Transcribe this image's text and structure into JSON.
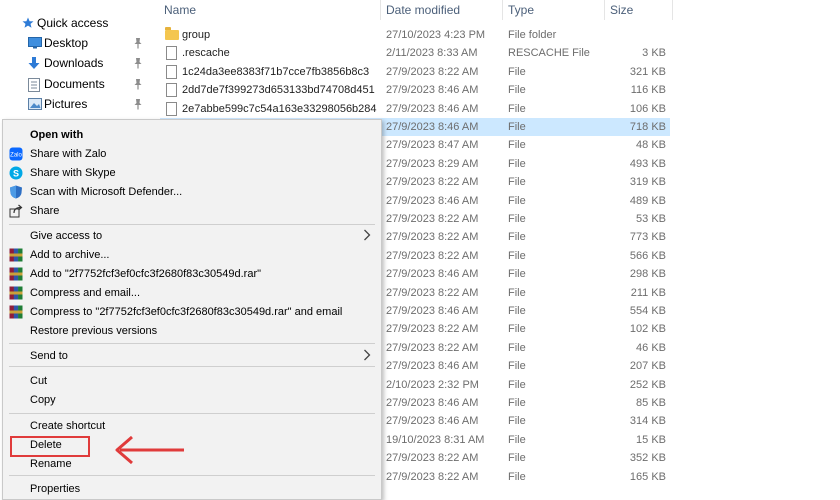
{
  "nav": {
    "items": [
      {
        "label": "Quick access",
        "icon": "star-icon",
        "pinned": false
      },
      {
        "label": "Desktop",
        "icon": "desktop-icon",
        "pinned": true
      },
      {
        "label": "Downloads",
        "icon": "download-icon",
        "pinned": true
      },
      {
        "label": "Documents",
        "icon": "document-icon",
        "pinned": true
      },
      {
        "label": "Pictures",
        "icon": "pictures-icon",
        "pinned": true
      }
    ]
  },
  "file_list": {
    "headers": [
      "Name",
      "Date modified",
      "Type",
      "Size"
    ],
    "rows": [
      {
        "name": "group",
        "date": "27/10/2023 4:23 PM",
        "type": "File folder",
        "size": "",
        "kind": "folder"
      },
      {
        "name": ".rescache",
        "date": "2/11/2023 8:33 AM",
        "type": "RESCACHE File",
        "size": "3 KB",
        "kind": "file"
      },
      {
        "name": "1c24da3ee8383f71b7cce7fb3856b8c3",
        "date": "27/9/2023 8:22 AM",
        "type": "File",
        "size": "321 KB",
        "kind": "file"
      },
      {
        "name": "2dd7de7f399273d653133bd74708d451",
        "date": "27/9/2023 8:46 AM",
        "type": "File",
        "size": "116 KB",
        "kind": "file"
      },
      {
        "name": "2e7abbe599c7c54a163e33298056b284",
        "date": "27/9/2023 8:46 AM",
        "type": "File",
        "size": "106 KB",
        "kind": "file"
      },
      {
        "name": "",
        "date": "27/9/2023 8:46 AM",
        "type": "File",
        "size": "718 KB",
        "kind": "file",
        "selected": true
      },
      {
        "name": "",
        "date": "27/9/2023 8:47 AM",
        "type": "File",
        "size": "48 KB",
        "kind": "file"
      },
      {
        "name": "",
        "date": "27/9/2023 8:29 AM",
        "type": "File",
        "size": "493 KB",
        "kind": "file"
      },
      {
        "name": "",
        "date": "27/9/2023 8:22 AM",
        "type": "File",
        "size": "319 KB",
        "kind": "file"
      },
      {
        "name": "",
        "date": "27/9/2023 8:46 AM",
        "type": "File",
        "size": "489 KB",
        "kind": "file"
      },
      {
        "name": "",
        "date": "27/9/2023 8:22 AM",
        "type": "File",
        "size": "53 KB",
        "kind": "file"
      },
      {
        "name": "",
        "date": "27/9/2023 8:22 AM",
        "type": "File",
        "size": "773 KB",
        "kind": "file"
      },
      {
        "name": "",
        "date": "27/9/2023 8:22 AM",
        "type": "File",
        "size": "566 KB",
        "kind": "file"
      },
      {
        "name": "",
        "date": "27/9/2023 8:46 AM",
        "type": "File",
        "size": "298 KB",
        "kind": "file"
      },
      {
        "name": "",
        "date": "27/9/2023 8:22 AM",
        "type": "File",
        "size": "211 KB",
        "kind": "file"
      },
      {
        "name": "",
        "date": "27/9/2023 8:46 AM",
        "type": "File",
        "size": "554 KB",
        "kind": "file"
      },
      {
        "name": "",
        "date": "27/9/2023 8:22 AM",
        "type": "File",
        "size": "102 KB",
        "kind": "file"
      },
      {
        "name": "",
        "date": "27/9/2023 8:22 AM",
        "type": "File",
        "size": "46 KB",
        "kind": "file"
      },
      {
        "name": "",
        "date": "27/9/2023 8:46 AM",
        "type": "File",
        "size": "207 KB",
        "kind": "file"
      },
      {
        "name": "",
        "date": "2/10/2023 2:32 PM",
        "type": "File",
        "size": "252 KB",
        "kind": "file"
      },
      {
        "name": "",
        "date": "27/9/2023 8:46 AM",
        "type": "File",
        "size": "85 KB",
        "kind": "file"
      },
      {
        "name": "",
        "date": "27/9/2023 8:46 AM",
        "type": "File",
        "size": "314 KB",
        "kind": "file"
      },
      {
        "name": "",
        "date": "19/10/2023 8:31 AM",
        "type": "File",
        "size": "15 KB",
        "kind": "file"
      },
      {
        "name": "",
        "date": "27/9/2023 8:22 AM",
        "type": "File",
        "size": "352 KB",
        "kind": "file"
      },
      {
        "name": "",
        "date": "27/9/2023 8:22 AM",
        "type": "File",
        "size": "165 KB",
        "kind": "file"
      }
    ]
  },
  "context_menu": {
    "items": [
      {
        "label": "Open with",
        "bold": true,
        "icon": "",
        "submenu": false
      },
      {
        "label": "Share with Zalo",
        "icon": "zalo-icon",
        "submenu": false
      },
      {
        "label": "Share with Skype",
        "icon": "skype-icon",
        "submenu": false
      },
      {
        "label": "Scan with Microsoft Defender...",
        "icon": "defender-shield-icon",
        "submenu": false
      },
      {
        "label": "Share",
        "icon": "share-icon",
        "submenu": false
      },
      {
        "sep": true
      },
      {
        "label": "Give access to",
        "icon": "",
        "submenu": true
      },
      {
        "label": "Add to archive...",
        "icon": "winrar-icon",
        "submenu": false
      },
      {
        "label": "Add to \"2f7752fcf3ef0cfc3f2680f83c30549d.rar\"",
        "icon": "winrar-icon",
        "submenu": false
      },
      {
        "label": "Compress and email...",
        "icon": "winrar-icon",
        "submenu": false
      },
      {
        "label": "Compress to \"2f7752fcf3ef0cfc3f2680f83c30549d.rar\" and email",
        "icon": "winrar-icon",
        "submenu": false
      },
      {
        "label": "Restore previous versions",
        "icon": "",
        "submenu": false
      },
      {
        "sep": true
      },
      {
        "label": "Send to",
        "icon": "",
        "submenu": true
      },
      {
        "sep": true
      },
      {
        "label": "Cut",
        "icon": "",
        "submenu": false
      },
      {
        "label": "Copy",
        "icon": "",
        "submenu": false
      },
      {
        "sep": true
      },
      {
        "label": "Create shortcut",
        "icon": "",
        "submenu": false
      },
      {
        "label": "Delete",
        "icon": "",
        "submenu": false,
        "highlighted": true
      },
      {
        "label": "Rename",
        "icon": "",
        "submenu": false
      },
      {
        "sep": true
      },
      {
        "label": "Properties",
        "icon": "",
        "submenu": false
      }
    ]
  },
  "colors": {
    "selection": "#cce8ff",
    "annotation_red": "#e03b3b",
    "menu_bg": "#f2f2f2"
  }
}
